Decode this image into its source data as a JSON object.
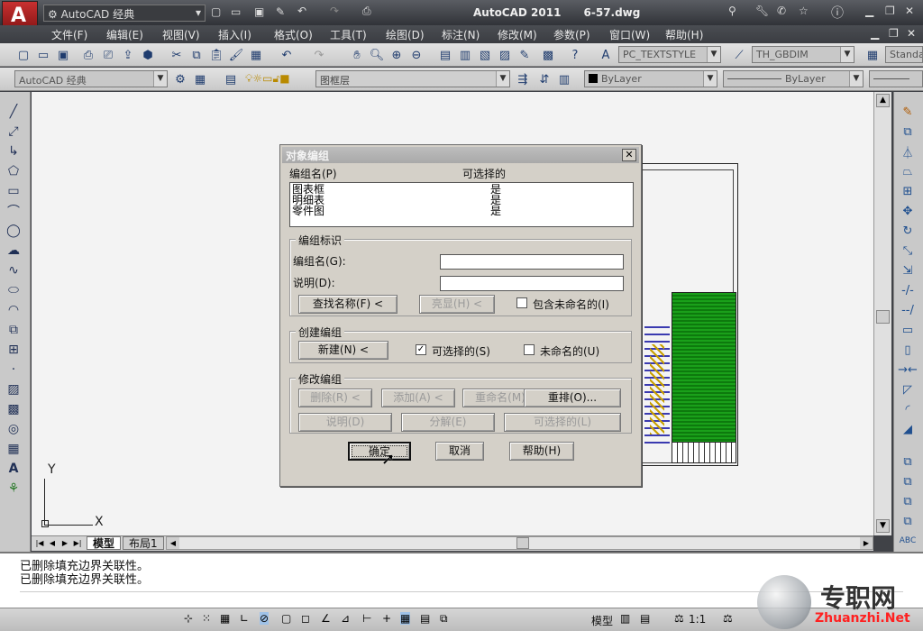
{
  "app": {
    "workspace_label": "AutoCAD 经典",
    "title": "AutoCAD 2011      6-57.dwg",
    "logo_letter": "A"
  },
  "menu": [
    "文件(F)",
    "编辑(E)",
    "视图(V)",
    "插入(I)",
    "格式(O)",
    "工具(T)",
    "绘图(D)",
    "标注(N)",
    "修改(M)",
    "参数(P)",
    "窗口(W)",
    "帮助(H)"
  ],
  "toolbar": {
    "text_style": "PC_TEXTSTYLE",
    "dim_style": "TH_GBDIM",
    "table_style": "Standa",
    "workspace_combo": "AutoCAD 经典",
    "layer": "图框层",
    "color": "ByLayer",
    "linetype": "ByLayer"
  },
  "dialog": {
    "title": "对象编组",
    "col_name": "编组名(P)",
    "col_selectable": "可选择的",
    "groups": [
      {
        "name": "图表框",
        "selectable": "是"
      },
      {
        "name": "明细表",
        "selectable": "是"
      },
      {
        "name": "零件图",
        "selectable": "是"
      }
    ],
    "id_section": "编组标识",
    "group_name_label": "编组名(G):",
    "desc_label": "说明(D):",
    "group_name_value": "",
    "desc_value": "",
    "find_name_btn": "查找名称(F) <",
    "highlight_btn": "亮显(H) <",
    "include_unnamed": "包含未命名的(I)",
    "create_section": "创建编组",
    "new_btn": "新建(N) <",
    "selectable_chk": "可选择的(S)",
    "unnamed_chk": "未命名的(U)",
    "modify_section": "修改编组",
    "remove_btn": "删除(R) <",
    "add_btn": "添加(A) <",
    "rename_btn": "重命名(M)",
    "reorder_btn": "重排(O)...",
    "desc_btn": "说明(D)",
    "explode_btn": "分解(E)",
    "selectable_btn": "可选择的(L)",
    "ok_btn": "确定",
    "cancel_btn": "取消",
    "help_btn": "帮助(H)"
  },
  "layout_tabs": [
    "模型",
    "布局1"
  ],
  "command_lines": [
    "已删除填充边界关联性。",
    "已删除填充边界关联性。"
  ],
  "status": {
    "model_label": "模型",
    "scale": "1:1"
  },
  "ucs": {
    "y": "Y",
    "x": "X"
  },
  "watermark": {
    "brand": "专职网",
    "url": "Zhuanzhi.Net"
  }
}
